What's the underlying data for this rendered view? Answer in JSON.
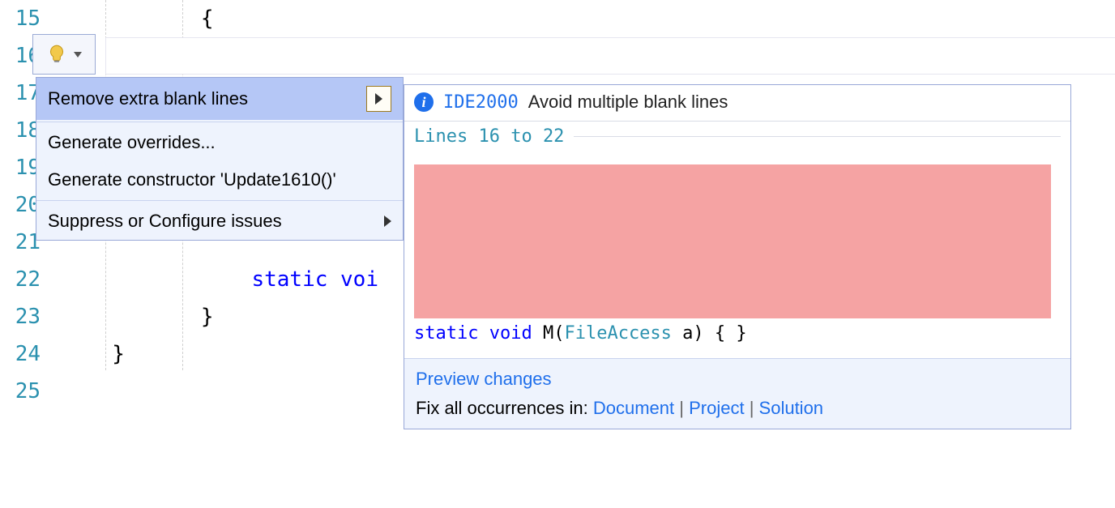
{
  "editor": {
    "line_numbers": [
      "15",
      "16",
      "17",
      "18",
      "19",
      "20",
      "21",
      "22",
      "23",
      "24",
      "25"
    ],
    "code": {
      "l15": "{",
      "l22_static": "static ",
      "l22_void": "voi",
      "l23": "}",
      "l24": "}"
    }
  },
  "bulb": {
    "icon": "lightbulb-icon"
  },
  "quick_actions": {
    "items": [
      {
        "label": "Remove extra blank lines",
        "has_submenu": true,
        "selected": true
      },
      {
        "label": "Generate overrides...",
        "has_submenu": false
      },
      {
        "label": "Generate constructor 'Update1610()'",
        "has_submenu": false
      },
      {
        "label": "Suppress or Configure issues",
        "has_submenu": true
      }
    ]
  },
  "preview": {
    "rule_id": "IDE2000",
    "rule_desc": "Avoid multiple blank lines",
    "range_label": "Lines 16 to 22",
    "code_tokens": {
      "kw_static": "static",
      "kw_void": "void",
      "method": " M(",
      "type": "FileAccess",
      "rest": " a) { }"
    },
    "footer": {
      "preview_link": "Preview changes",
      "fix_prefix": "Fix all occurrences in: ",
      "doc": "Document",
      "proj": "Project",
      "sol": "Solution",
      "sep": " | "
    }
  }
}
